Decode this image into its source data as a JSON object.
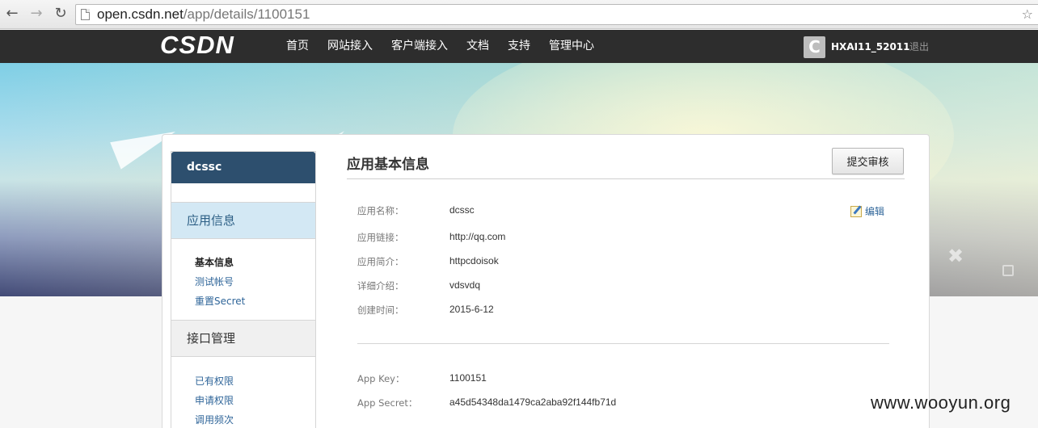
{
  "browser": {
    "url_host": "open.csdn.net",
    "url_path": "/app/details/1100151"
  },
  "topnav": {
    "logo": "CSDN",
    "menu": [
      "首页",
      "网站接入",
      "客户端接入",
      "文档",
      "支持",
      "管理中心"
    ],
    "avatar_letter": "C",
    "username": "HXAI11_52011",
    "logout": "退出"
  },
  "sidebar": {
    "app_name": "dcssc",
    "sections": [
      {
        "title": "应用信息",
        "active": true,
        "links": [
          "基本信息",
          "测试帐号",
          "重置Secret"
        ]
      },
      {
        "title": "接口管理",
        "active": false,
        "links": [
          "已有权限",
          "申请权限",
          "调用频次"
        ]
      }
    ]
  },
  "content": {
    "title": "应用基本信息",
    "submit_button": "提交审核",
    "edit_link": "编辑",
    "fields": [
      {
        "label": "应用名称：",
        "value": "dcssc"
      },
      {
        "label": "应用链接：",
        "value": "http://qq.com"
      },
      {
        "label": "应用简介：",
        "value": "httpcdoisok"
      },
      {
        "label": "详细介绍：",
        "value": "vdsvdq"
      },
      {
        "label": "创建时间：",
        "value": "2015-6-12"
      }
    ],
    "credentials": [
      {
        "label": "App Key：",
        "value": "1100151"
      },
      {
        "label": "App Secret：",
        "value": "a45d54348da1479ca2aba92f144fb71d"
      }
    ]
  },
  "watermark": "www.wooyun.org"
}
